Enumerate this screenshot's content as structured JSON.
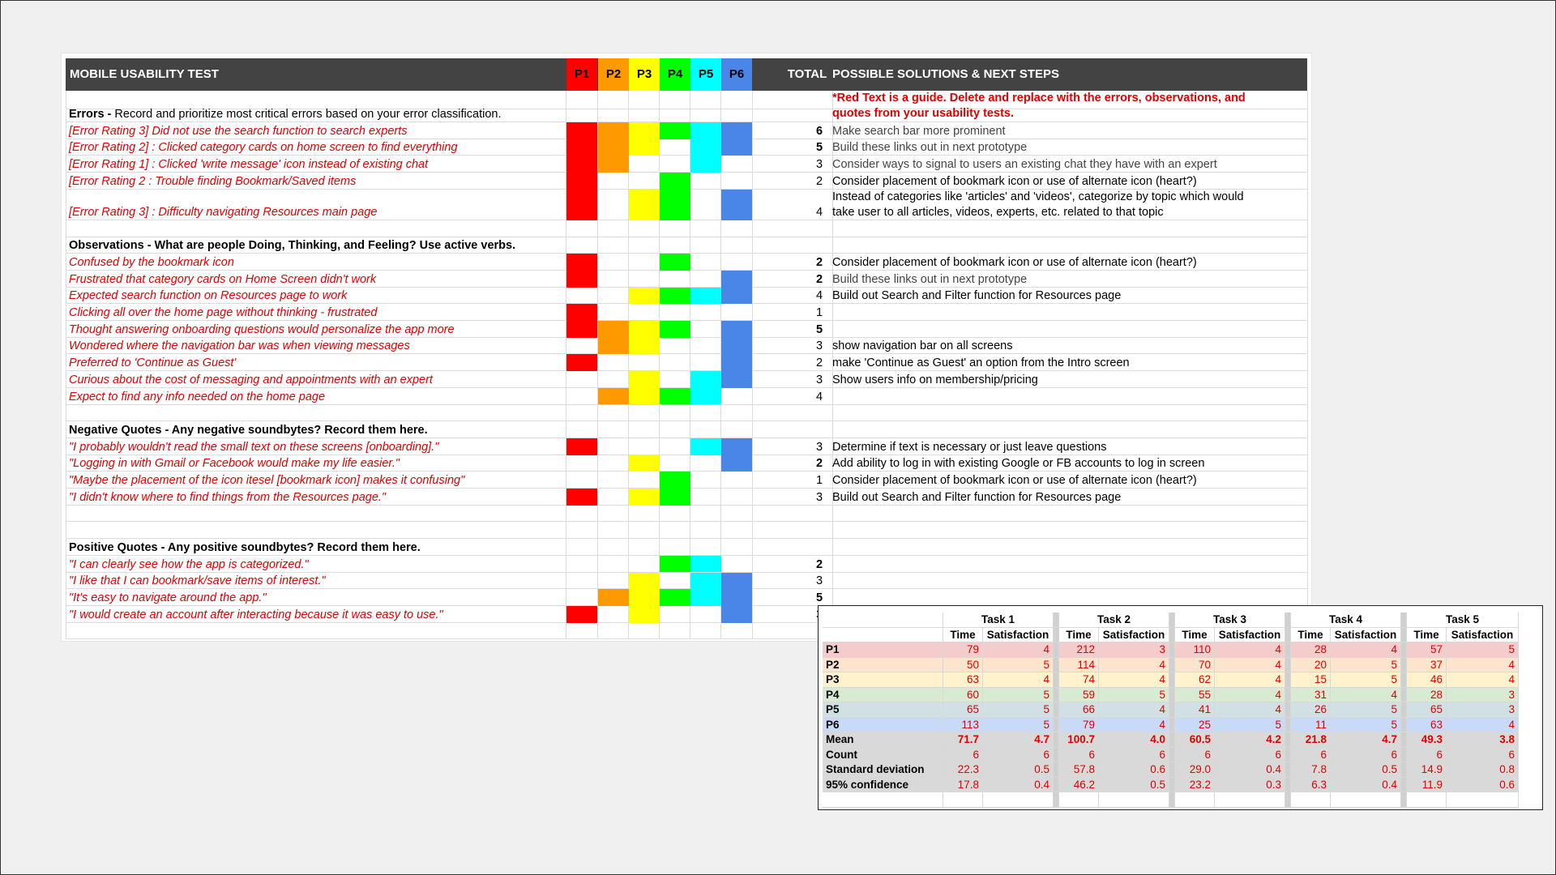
{
  "header": {
    "title": "MOBILE USABILITY TEST",
    "participants": [
      "P1",
      "P2",
      "P3",
      "P4",
      "P5",
      "P6"
    ],
    "total": "TOTAL",
    "solutions": "POSSIBLE SOLUTIONS & NEXT STEPS"
  },
  "colors": {
    "header_bg": "#434343",
    "P1": "#ff0000",
    "P2": "#ff9900",
    "P3": "#ffff00",
    "P4": "#00ff00",
    "P5": "#00ffff",
    "P6": "#4a86e8",
    "red_text": "#e00000"
  },
  "guide": {
    "line1": "*Red Text is a guide. Delete and replace with the errors, observations, and",
    "line2": "quotes from your usability tests."
  },
  "sections": {
    "errors": {
      "bold": "Errors - ",
      "rest": "Record and prioritize most critical errors based on your error classification."
    },
    "observations": {
      "bold": "Observations - What are people Doing, Thinking, and Feeling? Use active verbs.",
      "rest": ""
    },
    "negative": {
      "bold": "Negative Quotes - Any negative soundbytes? Record them here.",
      "rest": ""
    },
    "positive": {
      "bold": "Positive Quotes - Any positive soundbytes? Record them here.",
      "rest": ""
    }
  },
  "rows": [
    {
      "label": "[Error Rating 3] Did not use the search function to search experts",
      "marks": [
        1,
        1,
        1,
        1,
        1,
        1
      ],
      "total": "6",
      "bold": true,
      "solution": "Make search bar more prominent",
      "sol_style": "gray"
    },
    {
      "label": "[Error Rating 2] : Clicked category cards on home screen to find everything",
      "marks": [
        1,
        1,
        1,
        0,
        1,
        1
      ],
      "total": "5",
      "bold": true,
      "solution": "Build these links out in next prototype",
      "sol_style": "gray"
    },
    {
      "label": "[Error Rating 1] : Clicked 'write message' icon instead of existing chat",
      "marks": [
        1,
        1,
        0,
        0,
        1,
        0
      ],
      "total": "3",
      "bold": false,
      "solution": "Consider ways to signal to users an existing chat they have with an expert",
      "sol_style": "gray"
    },
    {
      "label": "[Error Rating 2 : Trouble finding Bookmark/Saved items",
      "marks": [
        1,
        0,
        0,
        1,
        0,
        0
      ],
      "total": "2",
      "bold": false,
      "solution": "Consider placement of bookmark icon or use of alternate icon (heart?)",
      "sol_style": ""
    },
    {
      "label": "[Error Rating 3] : Difficulty navigating Resources main page",
      "marks": [
        1,
        0,
        1,
        1,
        0,
        1
      ],
      "total": "4",
      "bold": false,
      "solution": "Instead of categories like 'articles' and 'videos', categorize by topic which would",
      "solution2": "take user to all articles, videos, experts, etc. related to that topic",
      "sol_style": "",
      "tall": true
    },
    {
      "label": "Confused by the bookmark icon",
      "marks": [
        1,
        0,
        0,
        1,
        0,
        0
      ],
      "total": "2",
      "bold": true,
      "solution": "Consider placement of bookmark icon or use of alternate icon (heart?)",
      "sol_style": ""
    },
    {
      "label": "Frustrated that category cards on Home Screen didn't work",
      "marks": [
        1,
        0,
        0,
        0,
        0,
        1
      ],
      "total": "2",
      "bold": true,
      "solution": "Build these links out in next prototype",
      "sol_style": "gray"
    },
    {
      "label": "Expected search function on Resources page to work",
      "marks": [
        0,
        0,
        1,
        1,
        1,
        1
      ],
      "total": "4",
      "bold": false,
      "solution": "Build out Search and Filter function for Resources page",
      "sol_style": ""
    },
    {
      "label": "Clicking all over the home page without thinking - frustrated",
      "marks": [
        1,
        0,
        0,
        0,
        0,
        0
      ],
      "total": "1",
      "bold": false,
      "solution": "",
      "sol_style": ""
    },
    {
      "label": "Thought answering onboarding questions would personalize the app more",
      "marks": [
        1,
        1,
        1,
        1,
        0,
        1
      ],
      "total": "5",
      "bold": true,
      "solution": "",
      "sol_style": ""
    },
    {
      "label": "Wondered where the navigation bar was when viewing messages",
      "marks": [
        0,
        1,
        1,
        0,
        0,
        1
      ],
      "total": "3",
      "bold": false,
      "solution": "show navigation bar on all screens",
      "sol_style": ""
    },
    {
      "label": "Preferred to 'Continue as Guest'",
      "marks": [
        1,
        0,
        0,
        0,
        0,
        1
      ],
      "total": "2",
      "bold": false,
      "solution": "make 'Continue as Guest' an option from the Intro screen",
      "sol_style": ""
    },
    {
      "label": "Curious about the cost of messaging and appointments with an expert",
      "marks": [
        0,
        0,
        1,
        0,
        1,
        1
      ],
      "total": "3",
      "bold": false,
      "solution": "Show users info on membership/pricing",
      "sol_style": ""
    },
    {
      "label": "Expect to find any info needed on the home page",
      "marks": [
        0,
        1,
        1,
        1,
        1,
        0
      ],
      "total": "4",
      "bold": false,
      "solution": "",
      "sol_style": ""
    },
    {
      "label": "\"I probably wouldn't read the small text on these screens [onboarding].\"",
      "marks": [
        1,
        0,
        0,
        0,
        1,
        1
      ],
      "total": "3",
      "bold": false,
      "solution": "Determine if text is necessary or just leave questions",
      "sol_style": ""
    },
    {
      "label": "\"Logging in with Gmail or Facebook would make my life easier.\"",
      "marks": [
        0,
        0,
        1,
        0,
        0,
        1
      ],
      "total": "2",
      "bold": true,
      "solution": "Add ability to log in with existing Google or FB accounts to log in screen",
      "sol_style": ""
    },
    {
      "label": "\"Maybe the placement of the icon itesel [bookmark icon] makes it confusing\"",
      "marks": [
        0,
        0,
        0,
        1,
        0,
        0
      ],
      "total": "1",
      "bold": false,
      "solution": "Consider placement of bookmark icon or use of alternate icon (heart?)",
      "sol_style": ""
    },
    {
      "label": "\"I didn't know where to find things from the Resources page.\"",
      "marks": [
        1,
        0,
        1,
        1,
        0,
        0
      ],
      "total": "3",
      "bold": false,
      "solution": "Build out Search and Filter function for Resources page",
      "sol_style": ""
    },
    {
      "label": "\"I can clearly see how the app is categorized.\"",
      "marks": [
        0,
        0,
        0,
        1,
        1,
        0
      ],
      "total": "2",
      "bold": true,
      "solution": "",
      "sol_style": ""
    },
    {
      "label": "\"I like that I can bookmark/save items of interest.\"",
      "marks": [
        0,
        0,
        1,
        0,
        1,
        1
      ],
      "total": "3",
      "bold": false,
      "solution": "",
      "sol_style": ""
    },
    {
      "label": "\"It's easy to navigate around the app.\"",
      "marks": [
        0,
        1,
        1,
        1,
        1,
        1
      ],
      "total": "5",
      "bold": true,
      "solution": "",
      "sol_style": ""
    },
    {
      "label": "\"I would create an account after interacting because it was easy to use.\"",
      "marks": [
        1,
        0,
        1,
        0,
        0,
        1
      ],
      "total": "3",
      "bold": false,
      "solution": "",
      "sol_style": ""
    }
  ],
  "metrics": {
    "tasks": [
      "Task 1",
      "Task 2",
      "Task 3",
      "Task 4",
      "Task 5"
    ],
    "subheads": [
      "Time",
      "Satisfaction"
    ],
    "rows": [
      {
        "label": "P1",
        "bg": "#f4cccc",
        "vals": [
          "79",
          "4",
          "212",
          "3",
          "110",
          "4",
          "28",
          "4",
          "57",
          "5"
        ]
      },
      {
        "label": "P2",
        "bg": "#fce5cd",
        "vals": [
          "50",
          "5",
          "114",
          "4",
          "70",
          "4",
          "20",
          "5",
          "37",
          "4"
        ]
      },
      {
        "label": "P3",
        "bg": "#fff2cc",
        "vals": [
          "63",
          "4",
          "74",
          "4",
          "62",
          "4",
          "15",
          "5",
          "46",
          "4"
        ]
      },
      {
        "label": "P4",
        "bg": "#d9ead3",
        "vals": [
          "60",
          "5",
          "59",
          "5",
          "55",
          "4",
          "31",
          "4",
          "28",
          "3"
        ]
      },
      {
        "label": "P5",
        "bg": "#d0e0e3",
        "vals": [
          "65",
          "5",
          "66",
          "4",
          "41",
          "4",
          "26",
          "5",
          "65",
          "3"
        ]
      },
      {
        "label": "P6",
        "bg": "#c9daf8",
        "vals": [
          "113",
          "5",
          "79",
          "4",
          "25",
          "5",
          "11",
          "5",
          "63",
          "4"
        ]
      },
      {
        "label": "Mean",
        "bg": "#d9d9d9",
        "bold": true,
        "vals": [
          "71.7",
          "4.7",
          "100.7",
          "4.0",
          "60.5",
          "4.2",
          "21.8",
          "4.7",
          "49.3",
          "3.8"
        ]
      },
      {
        "label": "Count",
        "bg": "#d9d9d9",
        "vals": [
          "6",
          "6",
          "6",
          "6",
          "6",
          "6",
          "6",
          "6",
          "6",
          "6"
        ]
      },
      {
        "label": "Standard deviation",
        "bg": "#d9d9d9",
        "vals": [
          "22.3",
          "0.5",
          "57.8",
          "0.6",
          "29.0",
          "0.4",
          "7.8",
          "0.5",
          "14.9",
          "0.8"
        ]
      },
      {
        "label": "95% confidence",
        "bg": "#d9d9d9",
        "vals": [
          "17.8",
          "0.4",
          "46.2",
          "0.5",
          "23.2",
          "0.3",
          "6.3",
          "0.4",
          "11.9",
          "0.6"
        ]
      }
    ]
  }
}
